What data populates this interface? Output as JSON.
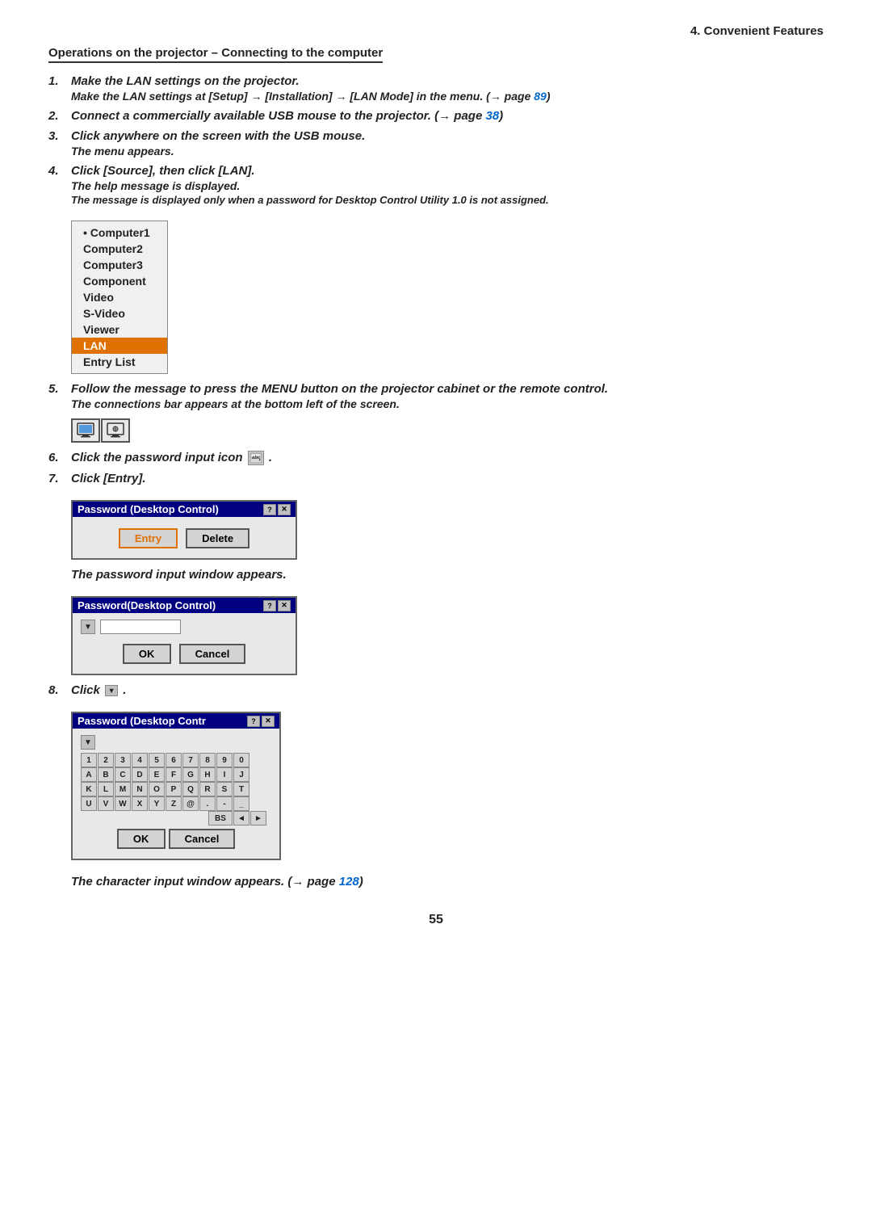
{
  "header": {
    "chapter": "4. Convenient Features"
  },
  "section": {
    "title": "Operations on the projector – Connecting to the computer"
  },
  "steps": [
    {
      "num": "1.",
      "main": "Make the LAN settings on the projector.",
      "sub": "Make the LAN settings at [Setup] → [Installation] → [LAN Mode] in the menu.  (→ page 89)"
    },
    {
      "num": "2.",
      "main": "Connect a commercially available USB mouse to the projector. (→ page 38)"
    },
    {
      "num": "3.",
      "main": "Click anywhere on the screen with the USB mouse.",
      "sub": "The menu appears."
    },
    {
      "num": "4.",
      "main": "Click [Source], then click [LAN].",
      "sub": "The help message is displayed.",
      "note": "The message is displayed only when a password for Desktop Control Utility 1.0 is not assigned."
    },
    {
      "num": "5.",
      "main": "Follow the message to press the MENU button on the projector cabinet or the remote control.",
      "sub": "The connections bar appears at the bottom left of the screen."
    },
    {
      "num": "6.",
      "main": "Click the password input icon"
    },
    {
      "num": "7.",
      "main": "Click [Entry].",
      "sub": "The password input window appears."
    },
    {
      "num": "8.",
      "main": "Click",
      "sub": "The character input window appears. (→ page 128)"
    }
  ],
  "menu": {
    "items": [
      "Computer1",
      "Computer2",
      "Computer3",
      "Component",
      "Video",
      "S-Video",
      "Viewer",
      "LAN",
      "Entry List"
    ],
    "selected": "LAN",
    "bullet": "Computer1"
  },
  "dialog1": {
    "title": "Password (Desktop Control)",
    "entry_btn": "Entry",
    "delete_btn": "Delete"
  },
  "dialog2": {
    "title": "Password(Desktop Control)",
    "ok_btn": "OK",
    "cancel_btn": "Cancel"
  },
  "dialog3": {
    "title": "Password (Desktop Contr",
    "keys_row1": [
      "1",
      "2",
      "3",
      "4",
      "5",
      "6",
      "7",
      "8",
      "9",
      "0"
    ],
    "keys_row2": [
      "A",
      "B",
      "C",
      "D",
      "E",
      "F",
      "G",
      "H",
      "I",
      "J"
    ],
    "keys_row3": [
      "K",
      "L",
      "M",
      "N",
      "O",
      "P",
      "Q",
      "R",
      "S",
      "T"
    ],
    "keys_row4": [
      "U",
      "V",
      "W",
      "X",
      "Y",
      "Z",
      "@",
      ".",
      "-",
      "_"
    ],
    "bs_btn": "BS",
    "ok_btn": "OK",
    "cancel_btn": "Cancel"
  },
  "page_number": "55"
}
